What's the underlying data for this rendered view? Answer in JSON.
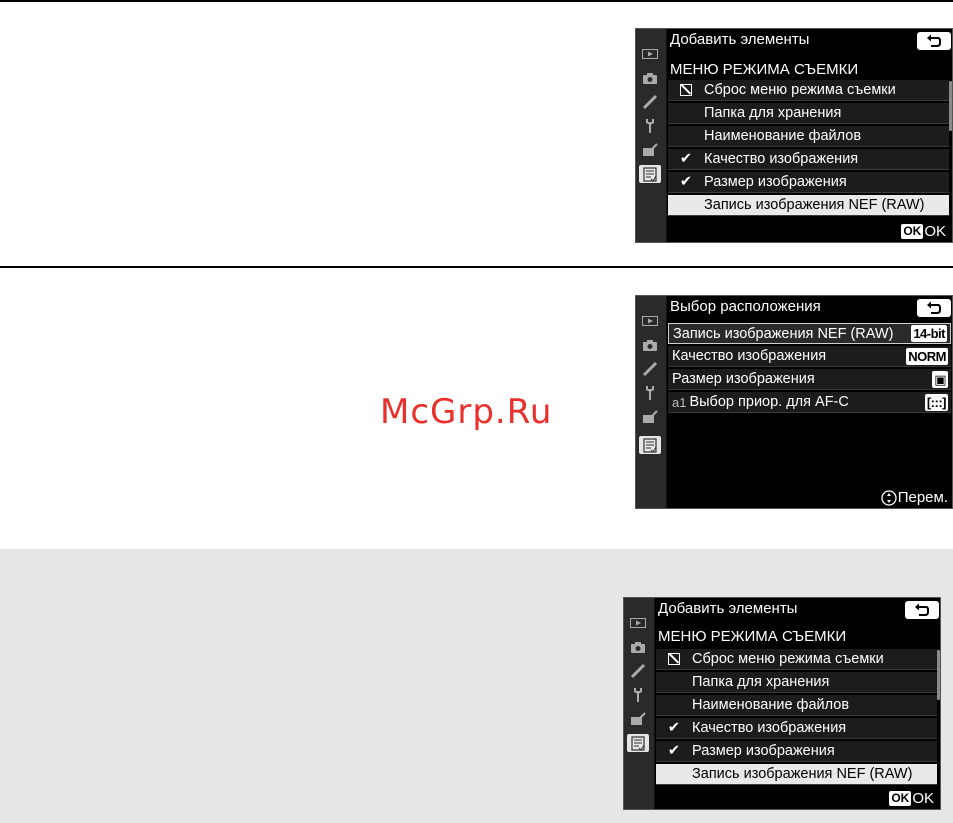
{
  "watermark": "McGrp.Ru",
  "screen1": {
    "title": "Добавить элементы",
    "subtitle": "МЕНЮ РЕЖИМА СЪЕМКИ",
    "items": [
      {
        "label": "Сброс меню режима съемки",
        "mark": "reset"
      },
      {
        "label": "Папка для хранения",
        "mark": ""
      },
      {
        "label": "Наименование файлов",
        "mark": ""
      },
      {
        "label": "Качество изображения",
        "mark": "check"
      },
      {
        "label": "Размер изображения",
        "mark": "check"
      },
      {
        "label": "Запись изображения NEF (RAW)",
        "mark": "",
        "selected": true
      }
    ],
    "ok_key": "OK",
    "ok_label": "OK"
  },
  "screen2": {
    "title": "Выбор расположения",
    "items": [
      {
        "prefix": "",
        "label": "Запись изображения NEF (RAW)",
        "value": "14-bit",
        "selected": true
      },
      {
        "prefix": "",
        "label": "Качество изображения",
        "value": "NORM"
      },
      {
        "prefix": "",
        "label": "Размер изображения",
        "value": "▣"
      },
      {
        "prefix": "a1",
        "label": "Выбор приор. для AF-C",
        "value": "[:::]"
      }
    ],
    "move_label": "Перем."
  },
  "screen3": {
    "title": "Добавить элементы",
    "subtitle": "МЕНЮ РЕЖИМА СЪЕМКИ",
    "items": [
      {
        "label": "Сброс меню режима съемки",
        "mark": "reset"
      },
      {
        "label": "Папка для хранения",
        "mark": ""
      },
      {
        "label": "Наименование файлов",
        "mark": ""
      },
      {
        "label": "Качество изображения",
        "mark": "check"
      },
      {
        "label": "Размер изображения",
        "mark": "check"
      },
      {
        "label": "Запись изображения NEF (RAW)",
        "mark": "",
        "selected": true
      }
    ],
    "ok_key": "OK",
    "ok_label": "OK"
  }
}
